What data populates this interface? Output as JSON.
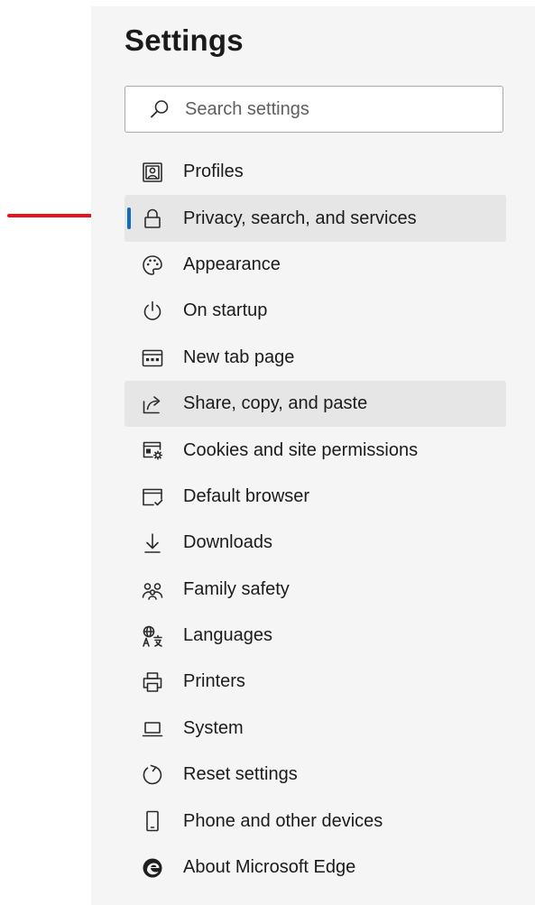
{
  "header": {
    "title": "Settings"
  },
  "search": {
    "placeholder": "Search settings",
    "value": ""
  },
  "sidebar": {
    "items": [
      {
        "label": "Profiles",
        "icon": "profile-icon"
      },
      {
        "label": "Privacy, search, and services",
        "icon": "lock-icon",
        "selected": true
      },
      {
        "label": "Appearance",
        "icon": "palette-icon"
      },
      {
        "label": "On startup",
        "icon": "power-icon"
      },
      {
        "label": "New tab page",
        "icon": "new-tab-icon"
      },
      {
        "label": "Share, copy, and paste",
        "icon": "share-icon",
        "hovered": true
      },
      {
        "label": "Cookies and site permissions",
        "icon": "cookies-icon"
      },
      {
        "label": "Default browser",
        "icon": "browser-icon"
      },
      {
        "label": "Downloads",
        "icon": "download-icon"
      },
      {
        "label": "Family safety",
        "icon": "family-icon"
      },
      {
        "label": "Languages",
        "icon": "language-icon"
      },
      {
        "label": "Printers",
        "icon": "printer-icon"
      },
      {
        "label": "System",
        "icon": "laptop-icon"
      },
      {
        "label": "Reset settings",
        "icon": "reset-icon"
      },
      {
        "label": "Phone and other devices",
        "icon": "phone-icon"
      },
      {
        "label": "About Microsoft Edge",
        "icon": "edge-logo-icon"
      }
    ]
  },
  "colors": {
    "panel_background": "#f5f5f5",
    "highlight_background": "#e6e6e6",
    "selected_indicator": "#0f6cbd",
    "annotation_arrow": "#e8141b",
    "text": "#1b1b1b"
  }
}
